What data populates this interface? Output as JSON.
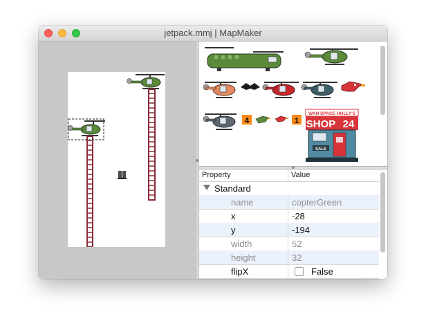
{
  "window": {
    "title": "jetpack.mmj | MapMaker"
  },
  "palette": {
    "items": [
      "chinook-helicopter-sprite",
      "green-helicopter-sprite",
      "orange-helicopter-sprite",
      "black-bat-sprite",
      "red-helicopter-sprite",
      "teal-helicopter-sprite",
      "red-bird-sprite",
      "gray-helicopter-sprite",
      "digit-4-tile",
      "small-green-bird-sprite",
      "small-red-bird-sprite",
      "digit-1-tile",
      "shop-building-sprite"
    ],
    "tile_four": "4",
    "tile_one": "1",
    "shop_sign_top": "WAN SPACE HOLLY'S",
    "shop_sign_main": "SHOP",
    "shop_sign_num": "24",
    "shop_sale": "SALE"
  },
  "properties": {
    "header": {
      "property": "Property",
      "value": "Value"
    },
    "group": "Standard",
    "rows": [
      {
        "key": "name",
        "value": "copterGreen",
        "editable": false
      },
      {
        "key": "x",
        "value": "-28",
        "editable": true
      },
      {
        "key": "y",
        "value": "-194",
        "editable": true
      },
      {
        "key": "width",
        "value": "52",
        "editable": false
      },
      {
        "key": "height",
        "value": "32",
        "editable": false
      },
      {
        "key": "flipX",
        "value": "False",
        "editable": true
      }
    ]
  },
  "colors": {
    "canvas_bg": "#c8c8c8",
    "row_alt": "#eaf1fb",
    "selection_dash": "#222222",
    "helicopter_green": "#5a8a3a",
    "ladder_red": "#8a2d3a",
    "shop_red": "#d8343a",
    "shop_teal": "#4f8aa0",
    "tile_orange": "#ff8a1a"
  }
}
